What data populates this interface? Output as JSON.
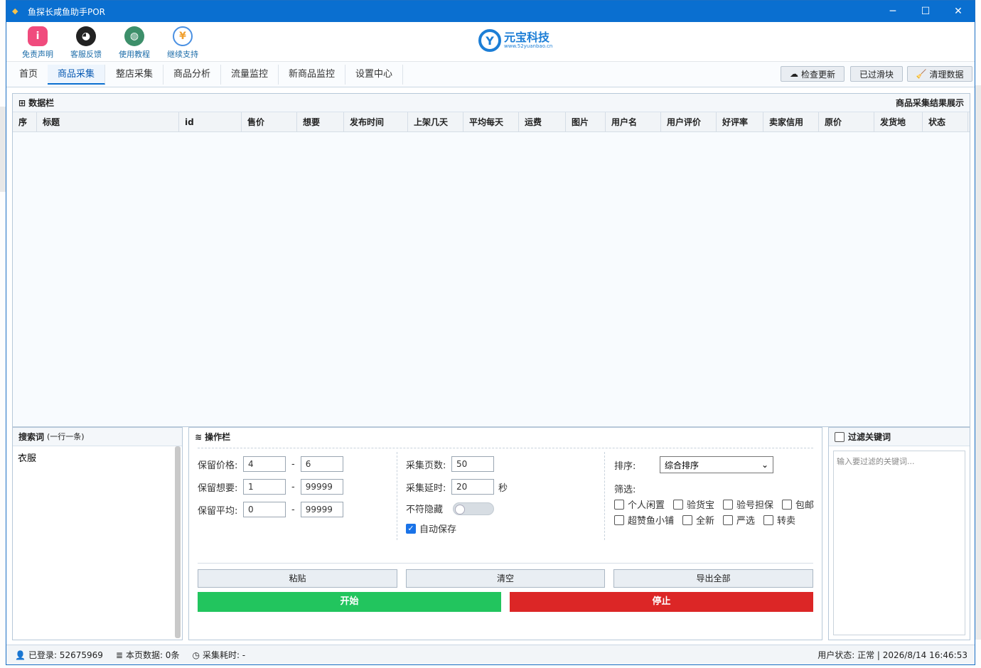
{
  "window": {
    "title": "鱼探长咸鱼助手POR"
  },
  "toolbar": [
    {
      "label": "免责声明",
      "icon": "info-icon",
      "color": "#f04b7d"
    },
    {
      "label": "客服反馈",
      "icon": "qq-penguin-icon",
      "color": "#222222"
    },
    {
      "label": "使用教程",
      "icon": "globe-icon",
      "color": "#3d8f6a"
    },
    {
      "label": "继续支持",
      "icon": "coin-plus-icon",
      "color": "#4a90e2"
    }
  ],
  "logo": {
    "mark": "Y",
    "text": "元宝科技",
    "sub": "www.52yuanbao.cn"
  },
  "tabs": [
    "首页",
    "商品采集",
    "整店采集",
    "商品分析",
    "流量监控",
    "新商品监控",
    "设置中心"
  ],
  "active_tab": "商品采集",
  "tab_buttons": {
    "check_update": "检查更新",
    "passed_slider": "已过滑块",
    "clear_data": "清理数据"
  },
  "data_panel": {
    "title": "数据栏",
    "right_title": "商品采集结果展示",
    "columns": [
      "序",
      "标题",
      "id",
      "售价",
      "想要",
      "发布时间",
      "上架几天",
      "平均每天",
      "运费",
      "图片",
      "用户名",
      "用户评价",
      "好评率",
      "卖家信用",
      "原价",
      "发货地",
      "状态"
    ]
  },
  "search_panel": {
    "title": "搜索词",
    "hint": "(一行一条)",
    "value": "衣服"
  },
  "ops_panel": {
    "title": "操作栏",
    "keep_price_label": "保留价格:",
    "keep_price_min": "4",
    "keep_price_max": "6",
    "keep_want_label": "保留想要:",
    "keep_want_min": "1",
    "keep_want_max": "99999",
    "keep_avg_label": "保留平均:",
    "keep_avg_min": "0",
    "keep_avg_max": "99999",
    "pages_label": "采集页数:",
    "pages_value": "50",
    "delay_label": "采集延时:",
    "delay_value": "20",
    "delay_unit": "秒",
    "hide_label": "不符隐藏",
    "autosave_label": "自动保存",
    "sort_label": "排序:",
    "sort_value": "综合排序",
    "filter_label": "筛选:",
    "filters": [
      "个人闲置",
      "验货宝",
      "验号担保",
      "包邮",
      "超赞鱼小铺",
      "全新",
      "严选",
      "转卖"
    ],
    "paste": "粘贴",
    "clear": "清空",
    "export": "导出全部",
    "start": "开始",
    "stop": "停止"
  },
  "filter_panel": {
    "title": "过滤关键词",
    "placeholder": "输入要过滤的关键词..."
  },
  "status_bar": {
    "logged_in": "已登录: 52675969",
    "page_data": "本页数据: 0条",
    "elapsed": "采集耗时: -",
    "right": "用户状态: 正常 | 2026/8/14 16:46:53"
  },
  "colors": {
    "accent": "#0a6fd0",
    "start": "#22c55e",
    "stop": "#dc2626"
  }
}
